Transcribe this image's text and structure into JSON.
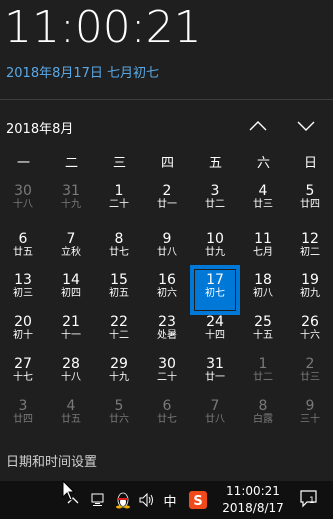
{
  "clock": {
    "time": "11:00:21",
    "date_text": "2018年8月17日 七月初七"
  },
  "calendar": {
    "month_label": "2018年8月",
    "weekdays": [
      "一",
      "二",
      "三",
      "四",
      "五",
      "六",
      "日"
    ],
    "weeks": [
      [
        {
          "d": "30",
          "l": "十八",
          "dim": true
        },
        {
          "d": "31",
          "l": "十九",
          "dim": true
        },
        {
          "d": "1",
          "l": "二十"
        },
        {
          "d": "2",
          "l": "廿一"
        },
        {
          "d": "3",
          "l": "廿二"
        },
        {
          "d": "4",
          "l": "廿三"
        },
        {
          "d": "5",
          "l": "廿四"
        }
      ],
      [
        {
          "d": "6",
          "l": "廿五"
        },
        {
          "d": "7",
          "l": "立秋"
        },
        {
          "d": "8",
          "l": "廿七"
        },
        {
          "d": "9",
          "l": "廿八"
        },
        {
          "d": "10",
          "l": "廿九"
        },
        {
          "d": "11",
          "l": "七月"
        },
        {
          "d": "12",
          "l": "初二"
        }
      ],
      [
        {
          "d": "13",
          "l": "初三"
        },
        {
          "d": "14",
          "l": "初四"
        },
        {
          "d": "15",
          "l": "初五"
        },
        {
          "d": "16",
          "l": "初六"
        },
        {
          "d": "17",
          "l": "初七",
          "today": true
        },
        {
          "d": "18",
          "l": "初八"
        },
        {
          "d": "19",
          "l": "初九"
        }
      ],
      [
        {
          "d": "20",
          "l": "初十"
        },
        {
          "d": "21",
          "l": "十一"
        },
        {
          "d": "22",
          "l": "十二"
        },
        {
          "d": "23",
          "l": "处暑"
        },
        {
          "d": "24",
          "l": "十四"
        },
        {
          "d": "25",
          "l": "十五"
        },
        {
          "d": "26",
          "l": "十六"
        }
      ],
      [
        {
          "d": "27",
          "l": "十七"
        },
        {
          "d": "28",
          "l": "十八"
        },
        {
          "d": "29",
          "l": "十九"
        },
        {
          "d": "30",
          "l": "二十"
        },
        {
          "d": "31",
          "l": "廿一"
        },
        {
          "d": "1",
          "l": "廿二",
          "dim": true
        },
        {
          "d": "2",
          "l": "廿三",
          "dim": true
        }
      ],
      [
        {
          "d": "3",
          "l": "廿四",
          "dim": true
        },
        {
          "d": "4",
          "l": "廿五",
          "dim": true
        },
        {
          "d": "5",
          "l": "廿六",
          "dim": true
        },
        {
          "d": "6",
          "l": "廿七",
          "dim": true
        },
        {
          "d": "7",
          "l": "廿八",
          "dim": true
        },
        {
          "d": "8",
          "l": "白露",
          "dim": true
        },
        {
          "d": "9",
          "l": "三十",
          "dim": true
        }
      ]
    ]
  },
  "settings_link": "日期和时间设置",
  "taskbar": {
    "ime_label": "中",
    "time": "11:00:21",
    "date": "2018/8/17",
    "notification_count": "1",
    "accent_color": "#0078d7"
  }
}
